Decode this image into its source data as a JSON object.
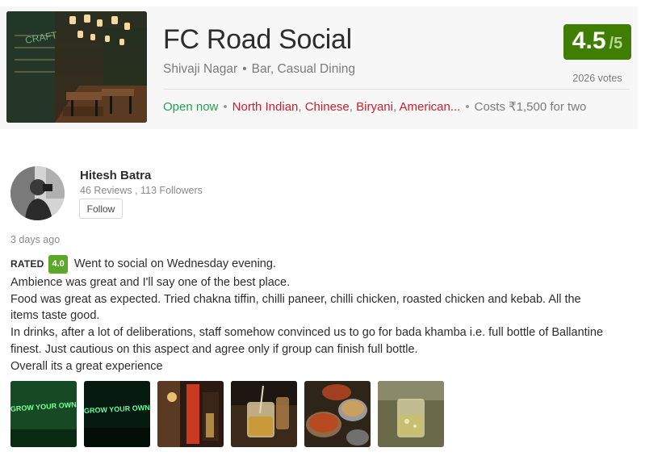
{
  "restaurant": {
    "name": "FC Road Social",
    "location": "Shivaji Nagar",
    "type": "Bar, Casual Dining",
    "rating_value": "4.5",
    "rating_scale": "/5",
    "votes": "2026 votes",
    "status": "Open now",
    "cuisines": [
      "North Indian",
      "Chinese",
      "Biryani",
      "American..."
    ],
    "cost": "Costs ₹1,500 for two",
    "rating_color": "#3f7e00",
    "status_color": "#24a24a",
    "cuisine_color": "#cb202d"
  },
  "reviewer": {
    "name": "Hitesh Batra",
    "stats": "46 Reviews , 113 Followers",
    "follow_label": "Follow"
  },
  "review": {
    "time": "3 days ago",
    "rated_label": "RATED",
    "rating": "4.0",
    "rating_badge_color": "#5ba829",
    "lines": [
      "Went to social on Wednesday evening.",
      "Ambience was great and I'll say one of the best place.",
      "Food was great as expected. Tried chakna tiffin, chilli paneer, chilli chicken, roasted chicken and kebab. All the",
      "items taste good.",
      "In drinks, after a lot of deliberations, staff somehow convinced us to go for bada khamba i.e. full bottle of Ballantine",
      "finest. Just cautious on this aspect and agree only if group can finish full bottle.",
      "Overall its a great experience"
    ],
    "photo_neon_text": "GROW YOUR OWN"
  }
}
